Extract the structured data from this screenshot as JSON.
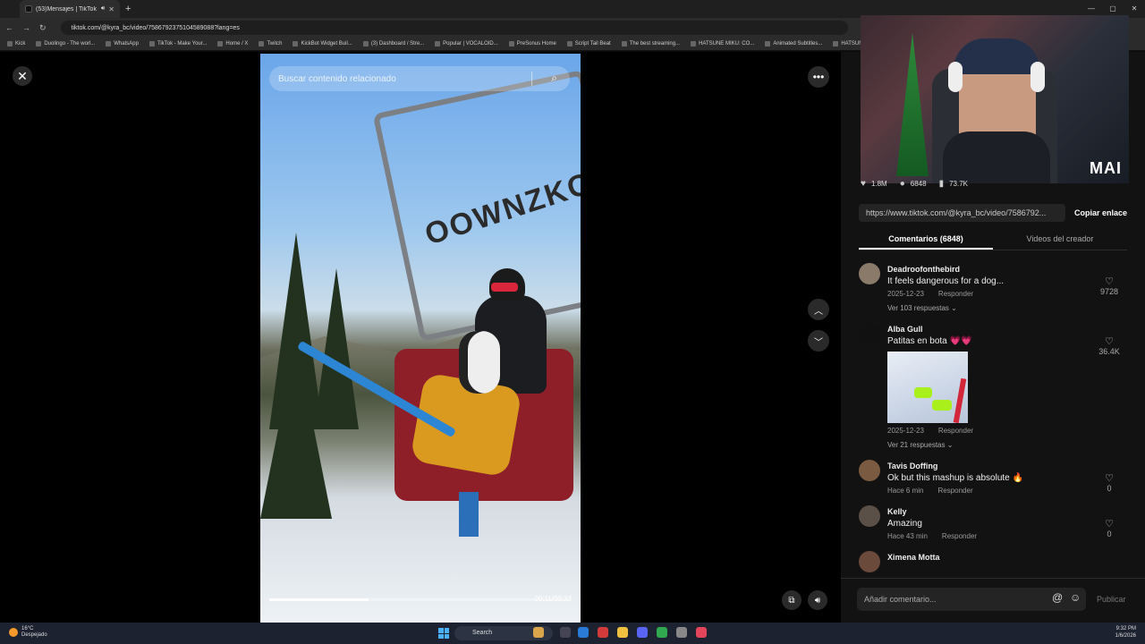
{
  "browser": {
    "tab_title": "(53)Mensajes | TikTok",
    "url": "tiktok.com/@kyra_bc/video/7586792375104589088?lang=es",
    "bookmarks": [
      "Kick",
      "Duolingo - The worl...",
      "WhatsApp",
      "TikTok - Make Your...",
      "Home / X",
      "Twitch",
      "KickBot Widget Buil...",
      "(3) Dashboard / Stre...",
      "Popular | VOCALOID...",
      "PreSonus Home",
      "Script Tail Beat",
      "The best streaming...",
      "HATSUNE MIKU: CO...",
      "Animated Subtitles...",
      "HATSUNE M"
    ]
  },
  "video": {
    "search_placeholder": "Buscar contenido relacionado",
    "timecode": "00:11/00:33",
    "progress": 0.33,
    "overlay_text": "OOWNZKOO"
  },
  "webcam": {
    "label": "MAI"
  },
  "stats": {
    "likes": "1.8M",
    "comments": "6848",
    "saves": "73.7K"
  },
  "link": {
    "url": "https://www.tiktok.com/@kyra_bc/video/7586792...",
    "copy_label": "Copiar enlace"
  },
  "tabs": {
    "comments": "Comentarios (6848)",
    "creator_videos": "Videos del creador"
  },
  "comments": [
    {
      "user": "Deadroofonthebird",
      "text": "It feels dangerous for a dog...",
      "date": "2025-12-23",
      "reply": "Responder",
      "replies": "Ver 103 respuestas",
      "likes": "9728"
    },
    {
      "user": "Alba Gull",
      "text": "Patitas en bota 💗💗",
      "date": "2025-12-23",
      "reply": "Responder",
      "replies": "Ver 21 respuestas",
      "likes": "36.4K"
    },
    {
      "user": "Tavis Doffing",
      "text": "Ok but this mashup is absolute 🔥",
      "date": "Hace 6 min",
      "reply": "Responder",
      "likes": "0"
    },
    {
      "user": "Kelly",
      "text": "Amazing",
      "date": "Hace 43 min",
      "reply": "Responder",
      "likes": "0"
    },
    {
      "user": "Ximena Motta"
    }
  ],
  "comment_box": {
    "placeholder": "Añadir comentario...",
    "post_label": "Publicar"
  },
  "taskbar": {
    "temp": "16°C",
    "weather": "Despejado",
    "search": "Search",
    "time": "9:32 PM",
    "date": "1/6/2026"
  }
}
